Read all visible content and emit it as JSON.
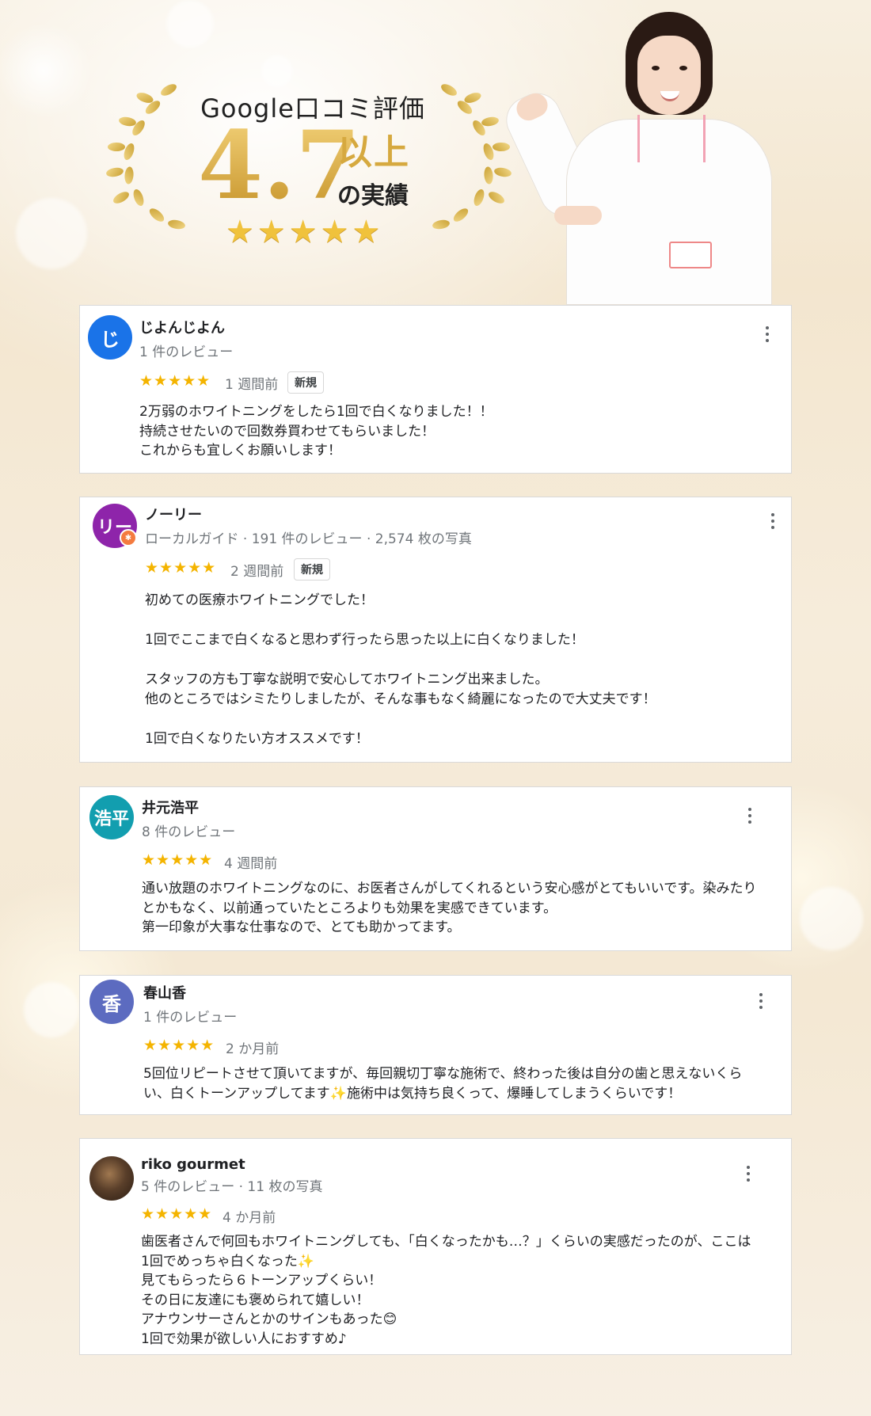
{
  "hero": {
    "title": "Google口コミ評価",
    "rating": "4.7",
    "suffix": "以上",
    "subtitle": "の実績",
    "stars": "★★★★★"
  },
  "reviews": [
    {
      "avatar_text": "じ",
      "avatar_color": "#1a73e8",
      "name": "じよんじよん",
      "meta": "1 件のレビュー",
      "stars": "★★★★★",
      "date": "1 週間前",
      "badge": "新規",
      "text": "2万弱のホワイトニングをしたら1回で白くなりました！！\n持続させたいので回数券買わせてもらいました！\nこれからも宜しくお願いします！"
    },
    {
      "avatar_text": "リー",
      "avatar_color": "#8e24aa",
      "name": "ノーリー",
      "meta": "ローカルガイド · 191 件のレビュー · 2,574 枚の写真",
      "stars": "★★★★★",
      "date": "2 週間前",
      "badge": "新規",
      "text": "初めての医療ホワイトニングでした！\n\n1回でここまで白くなると思わず行ったら思った以上に白くなりました！\n\nスタッフの方も丁寧な説明で安心してホワイトニング出来ました。\n他のところではシミたりしましたが、そんな事もなく綺麗になったので大丈夫です！\n\n1回で白くなりたい方オススメです！"
    },
    {
      "avatar_text": "浩平",
      "avatar_color": "#129eaf",
      "name": "井元浩平",
      "meta": "8 件のレビュー",
      "stars": "★★★★★",
      "date": "4 週間前",
      "text": "通い放題のホワイトニングなのに、お医者さんがしてくれるという安心感がとてもいいです。染みたり\nとかもなく、以前通っていたところよりも効果を実感できています。\n第一印象が大事な仕事なので、とても助かってます。"
    },
    {
      "avatar_text": "香",
      "avatar_color": "#5c6bc0",
      "name": "春山香",
      "meta": "1 件のレビュー",
      "stars": "★★★★★",
      "date": "2 か月前",
      "text": "5回位リピートさせて頂いてますが、毎回親切丁寧な施術で、終わった後は自分の歯と思えないくら\nい、白くトーンアップしてます✨施術中は気持ち良くって、爆睡してしまうくらいです！"
    },
    {
      "avatar_text": "",
      "avatar_color": "#4a3526",
      "name": "riko gourmet",
      "meta": "5 件のレビュー · 11 枚の写真",
      "stars": "★★★★★",
      "date": "4 か月前",
      "text": "歯医者さんで何回もホワイトニングしても、「白くなったかも…？」くらいの実感だったのが、ここは\n1回でめっちゃ白くなった✨\n見てもらったら６トーンアップくらい！\nその日に友達にも褒められて嬉しい！\nアナウンサーさんとかのサインもあった😊\n1回で効果が欲しい人におすすめ♪"
    }
  ]
}
